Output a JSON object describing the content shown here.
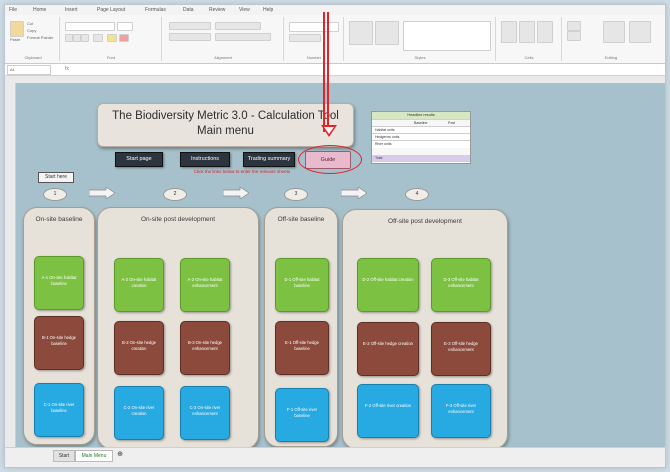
{
  "ribbon": {
    "tabs": [
      "File",
      "Home",
      "Insert",
      "Page Layout",
      "Formulas",
      "Data",
      "Review",
      "View",
      "Help"
    ],
    "groups": [
      "Clipboard",
      "Font",
      "Alignment",
      "Number",
      "Styles",
      "Cells",
      "Editing"
    ],
    "paste_label": "Paste",
    "cut_label": "Cut",
    "copy_label": "Copy",
    "format_painter_label": "Format Painter"
  },
  "formula_bar": {
    "name_box": "A1",
    "fx": "fx"
  },
  "title": {
    "line1": "The Biodiversity Metric 3.0 - Calculation Tool",
    "line2": "Main menu"
  },
  "nav_buttons": {
    "start_page": "Start page",
    "instructions": "Instructions",
    "trading_summary": "Trading summary",
    "guide": "Guide"
  },
  "red_note": "Click the links below to enter the relevant sheets",
  "start_here": "Start here",
  "steps": [
    "1",
    "2",
    "3",
    "4"
  ],
  "mini_table": {
    "header": "Headline results",
    "col1": "Baseline",
    "col2": "Post",
    "rows": [
      "Habitat units",
      "Hedgerow units",
      "River units"
    ],
    "total": "Total"
  },
  "panels": {
    "onsite_baseline": {
      "title": "On-site baseline",
      "tiles": [
        "A-1 On-site habitat baseline",
        "B-1 On-site hedge baseline",
        "C-1 On-site river baseline"
      ]
    },
    "onsite_post": {
      "title": "On-site post development",
      "tiles": [
        "A-2 On-site habitat creation",
        "A-3 On-site habitat enhancement",
        "B-2 On-site hedge creation",
        "B-3 On-site hedge enhancement",
        "C-2 On-site river creation",
        "C-3 On-site river enhancement"
      ]
    },
    "offsite_baseline": {
      "title": "Off-site baseline",
      "tiles": [
        "D-1 Off-site habitat baseline",
        "E-1 Off-site hedge baseline",
        "F-1 Off-site river baseline"
      ]
    },
    "offsite_post": {
      "title": "Off-site post development",
      "tiles": [
        "D-2 Off-site habitat creation",
        "D-3 Off-site habitat enhancement",
        "E-2 Off-site hedge creation",
        "E-3 Off-site hedge enhancement",
        "F-2 Off-site river creation",
        "F-3 Off-site river enhancement"
      ]
    }
  },
  "sheet_tabs": [
    "Start",
    "Main Menu"
  ],
  "colors": {
    "accent_red": "#e4222a",
    "green": "#7cc142",
    "brown": "#8b4a3c",
    "blue": "#27a9e1",
    "sheet_bg": "#a6c1cb"
  }
}
